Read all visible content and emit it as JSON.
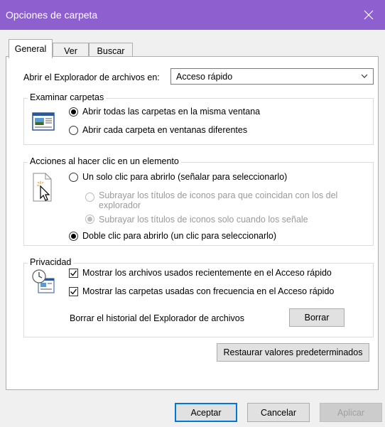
{
  "window": {
    "title": "Opciones de carpeta"
  },
  "tabs": [
    {
      "label": "General"
    },
    {
      "label": "Ver"
    },
    {
      "label": "Buscar"
    }
  ],
  "open_explorer": {
    "label": "Abrir el Explorador de archivos en:",
    "value": "Acceso rápido"
  },
  "browse": {
    "legend": "Examinar carpetas",
    "options": [
      {
        "label": "Abrir todas las carpetas en la misma ventana",
        "selected": true
      },
      {
        "label": "Abrir cada carpeta en ventanas diferentes",
        "selected": false
      }
    ]
  },
  "click": {
    "legend": "Acciones al hacer clic en un elemento",
    "single": "Un solo clic para abrirlo (señalar para seleccionarlo)",
    "sub1_line1": "Subrayar los títulos de iconos para que coincidan con los del",
    "sub1_line2": "explorador",
    "sub2": "Subrayar los títulos de iconos solo cuando los señale",
    "double": "Doble clic para abrirlo (un clic para seleccionarlo)"
  },
  "privacy": {
    "legend": "Privacidad",
    "recent": "Mostrar los archivos usados recientemente en el Acceso rápido",
    "frequent": "Mostrar las carpetas usadas con frecuencia en el Acceso rápido",
    "clear_label": "Borrar el historial del Explorador de archivos",
    "clear_button": "Borrar"
  },
  "restore_button": "Restaurar valores predeterminados",
  "footer": {
    "ok": "Aceptar",
    "cancel": "Cancelar",
    "apply": "Aplicar"
  },
  "colors": {
    "titlebar": "#8d5fcf",
    "accent": "#0078d7"
  }
}
